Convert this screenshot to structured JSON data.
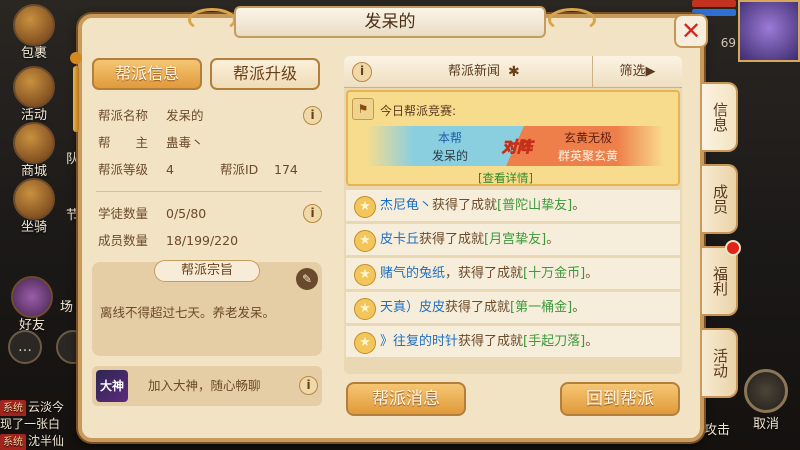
{
  "scene": {
    "hud_left": [
      {
        "label": "包裹",
        "icon": "bag-icon"
      },
      {
        "label": "活动",
        "icon": "horn-icon"
      },
      {
        "label": "商城",
        "icon": "shop-icon"
      },
      {
        "label": "坐骑",
        "icon": "mount-icon"
      }
    ],
    "hud_left_partial": [
      "队",
      "节",
      "场"
    ],
    "friends_label": "好友",
    "chat_lines": [
      {
        "tag": "系统",
        "text": "云淡今"
      },
      {
        "tag": "",
        "text": "现了一张白"
      },
      {
        "tag": "系统",
        "text": "沈半仙"
      }
    ],
    "level": "69",
    "attack_label": "攻击",
    "cancel_label": "取消"
  },
  "panel": {
    "title": "发呆的",
    "close_label": "✕"
  },
  "tabs": [
    {
      "label": "帮派信息",
      "active": true
    },
    {
      "label": "帮派升级",
      "active": false
    }
  ],
  "guild_info": {
    "name_key": "帮派名称",
    "name_value": "发呆的",
    "master_key": "帮　　主",
    "master_value": "蛊毒丶",
    "level_key": "帮派等级",
    "level_value": "4",
    "id_key": "帮派ID",
    "id_value": "174",
    "apprentice_key": "学徒数量",
    "apprentice_value": "0/5/80",
    "member_key": "成员数量",
    "member_value": "18/199/220"
  },
  "tenet": {
    "label": "帮派宗旨",
    "text": "离线不得超过七天。养老发呆。"
  },
  "dashen": {
    "logo": "大神",
    "text": "加入大神，随心畅聊"
  },
  "news": {
    "title": "帮派新闻",
    "filter_label": "筛选▶"
  },
  "contest": {
    "heading": "今日帮派竞赛:",
    "left_label": "本帮",
    "left_name": "发呆的",
    "vs": "对阵",
    "right_label": "玄黄无极",
    "right_name": "群英聚玄黄",
    "details": "[查看详情]"
  },
  "news_items": [
    {
      "player": "杰尼龟丶",
      "middle": "获得了成就",
      "achievement": "[普陀山挚友]",
      "end": "。"
    },
    {
      "player": "皮卡丘",
      "middle": "获得了成就",
      "achievement": "[月宫挚友]",
      "end": "。"
    },
    {
      "player": "赌气的兔纸",
      "middle": "，获得了成就",
      "achievement": "[十万金币]",
      "end": "。"
    },
    {
      "player": "天真）皮皮",
      "middle": "获得了成就",
      "achievement": "[第一桶金]",
      "end": "。"
    },
    {
      "player": "》往复的时针",
      "middle": "获得了成就",
      "achievement": "[手起刀落]",
      "end": "。"
    }
  ],
  "buttons": {
    "message": "帮派消息",
    "return": "回到帮派"
  },
  "side_tabs": [
    "信息",
    "成员",
    "福利",
    "活动"
  ],
  "colors": {
    "tab_active": "#e09a3b",
    "player_name": "#1f6fc2",
    "achievement": "#3d9a3a",
    "vs_left": "#89cfe0",
    "vs_right": "#ee7e4a",
    "close_x": "#d0281f"
  }
}
